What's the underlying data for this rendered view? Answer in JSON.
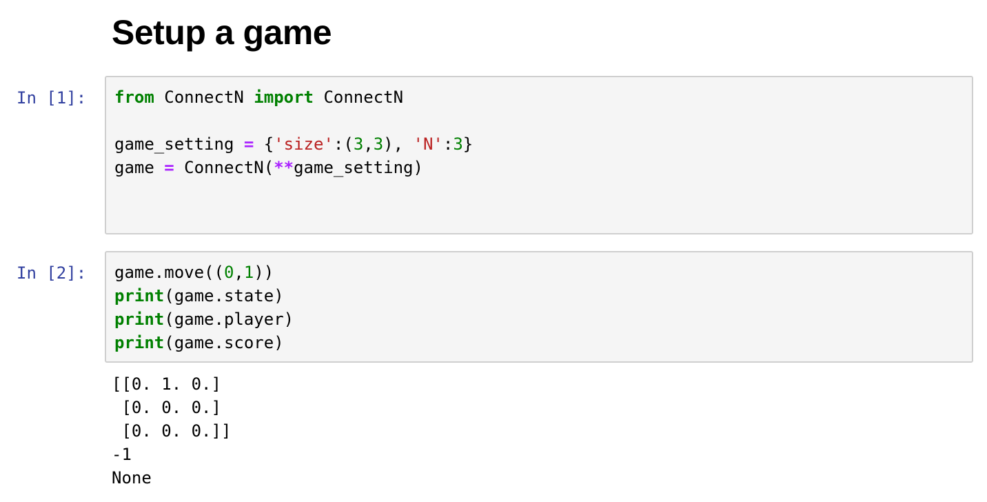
{
  "section": {
    "heading": "Setup a game"
  },
  "cells": [
    {
      "prompt": "In [1]:",
      "code": {
        "line1": {
          "kw_from": "from",
          "mod": " ConnectN ",
          "kw_import": "import",
          "name": " ConnectN"
        },
        "line3": {
          "var": "game_setting ",
          "eq": "=",
          "open": " {",
          "s1": "'size'",
          "colon1": ":(",
          "n1": "3",
          "comma1": ",",
          "n2": "3",
          "close1": "), ",
          "s2": "'N'",
          "colon2": ":",
          "n3": "3",
          "close2": "}"
        },
        "line4": {
          "var": "game ",
          "eq": "=",
          "call": " ConnectN(",
          "star": "**",
          "arg": "game_setting)"
        }
      }
    },
    {
      "prompt": "In [2]:",
      "code": {
        "line1": {
          "pre": "game.move((",
          "n1": "0",
          "comma": ",",
          "n2": "1",
          "post": "))"
        },
        "line2": {
          "fn": "print",
          "args": "(game.state)"
        },
        "line3": {
          "fn": "print",
          "args": "(game.player)"
        },
        "line4": {
          "fn": "print",
          "args": "(game.score)"
        }
      },
      "output": [
        "[[0. 1. 0.]",
        " [0. 0. 0.]",
        " [0. 0. 0.]]",
        "-1",
        "None"
      ]
    }
  ],
  "colors": {
    "prompt": "#303f9f",
    "keyword": "#008000",
    "operator": "#aa22ff",
    "string": "#ba2121",
    "number": "#008000",
    "cell_background": "#f5f5f5",
    "cell_border": "#cfcfcf"
  }
}
